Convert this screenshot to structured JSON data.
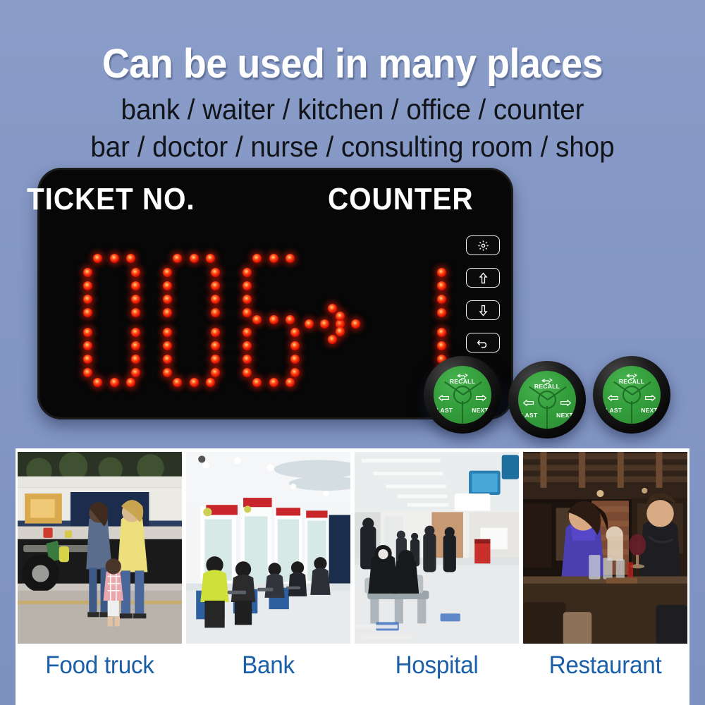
{
  "background_color": "#8396c4",
  "headline": {
    "title": "Can be used in many places",
    "line1": "bank / waiter / kitchen / office / counter",
    "line2": "bar / doctor / nurse  / consulting room / shop",
    "title_color": "#ffffff",
    "subline_color": "#111419"
  },
  "device": {
    "ticket_label": "TICKET NO.",
    "counter_label": "COUNTER",
    "bezel_color": "#070707",
    "led_color": "#e01206",
    "display": {
      "ticket_number": "006",
      "arrow": "→",
      "counter_number": "1"
    },
    "side_buttons": [
      {
        "name": "settings-button",
        "icon": "gear-icon",
        "label": ""
      },
      {
        "name": "up-button",
        "icon": "arrow-up-icon",
        "label": ""
      },
      {
        "name": "down-button",
        "icon": "arrow-down-icon",
        "label": ""
      },
      {
        "name": "back-button",
        "icon": "undo-arrow-icon",
        "label": ""
      }
    ]
  },
  "call_buttons": [
    {
      "recall": "RECALL",
      "last": "LAST",
      "next": "NEXT",
      "color": "#34a03c"
    },
    {
      "recall": "RECALL",
      "last": "LAST",
      "next": "NEXT",
      "color": "#34a03c"
    },
    {
      "recall": "RECALL",
      "last": "LAST",
      "next": "NEXT",
      "color": "#34a03c"
    }
  ],
  "photo_strip": {
    "caption_color": "#1a5fa8",
    "items": [
      {
        "caption": "Food truck",
        "scene": "food-truck"
      },
      {
        "caption": "Bank",
        "scene": "bank-counters"
      },
      {
        "caption": "Hospital",
        "scene": "hospital-corridor"
      },
      {
        "caption": "Restaurant",
        "scene": "restaurant-diners"
      }
    ]
  }
}
